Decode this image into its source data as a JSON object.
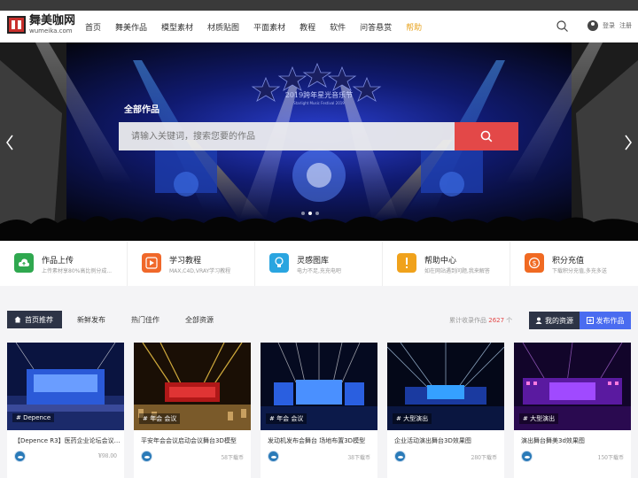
{
  "site": {
    "logo_cn": "舞美咖网",
    "logo_en": "wumeika.com"
  },
  "nav": {
    "items": [
      "首页",
      "舞美作品",
      "模型素材",
      "材质贴图",
      "平面素材",
      "教程",
      "软件",
      "问答悬赏",
      "帮助"
    ],
    "active_index": 8,
    "login": "登录",
    "register": "注册"
  },
  "hero": {
    "title": "全部作品",
    "search_placeholder": "请输入关键词，搜索您要的作品",
    "banner_text_line1": "2019跨年星光音乐节",
    "banner_text_line2": "Starlight Music Festival 2019"
  },
  "features": [
    {
      "title": "作品上传",
      "desc": "上传素材享80%高比例分成...",
      "color": "#2fa84f",
      "icon": "cloud-upload-icon"
    },
    {
      "title": "学习教程",
      "desc": "MAX,C4D,VRAY学习教程",
      "color": "#f0682a",
      "icon": "play-icon"
    },
    {
      "title": "灵感图库",
      "desc": "电力不足,充充电吧",
      "color": "#2aa5e0",
      "icon": "bulb-icon"
    },
    {
      "title": "帮助中心",
      "desc": "如在网站遇到问题,我来解答",
      "color": "#f0a21c",
      "icon": "exclamation-icon"
    },
    {
      "title": "积分充值",
      "desc": "下载积分充值,多充多送",
      "color": "#f06a22",
      "icon": "dollar-icon"
    }
  ],
  "tabs": {
    "items": [
      "首页推荐",
      "新鲜发布",
      "热门佳作",
      "全部资源"
    ],
    "count_label": "累计收录作品",
    "count_value": "2627",
    "count_unit": "个",
    "my_resources": "我的资源",
    "publish": "发布作品"
  },
  "cards": [
    {
      "tag": "# Depence",
      "title": "【Depence R3】医药企业论坛会议舞台模...",
      "price": "¥98.00"
    },
    {
      "tag": "# 年会 会议",
      "title": "平安年会会议启动会议舞台3D模型",
      "price": "58下载币"
    },
    {
      "tag": "# 年会 会议",
      "title": "发动机发布会舞台 场地布置3D模型",
      "price": "38下载币"
    },
    {
      "tag": "# 大型演出",
      "title": "企业活动演出舞台3D效果图",
      "price": "280下载币"
    },
    {
      "tag": "# 大型演出",
      "title": "演出舞台舞美3d效果图",
      "price": "150下载币"
    }
  ],
  "colors": {
    "accent_red": "#e34848",
    "nav_active": "#e8a31e",
    "tab_dark": "#2d3446",
    "publish_blue": "#4a6cf0"
  }
}
